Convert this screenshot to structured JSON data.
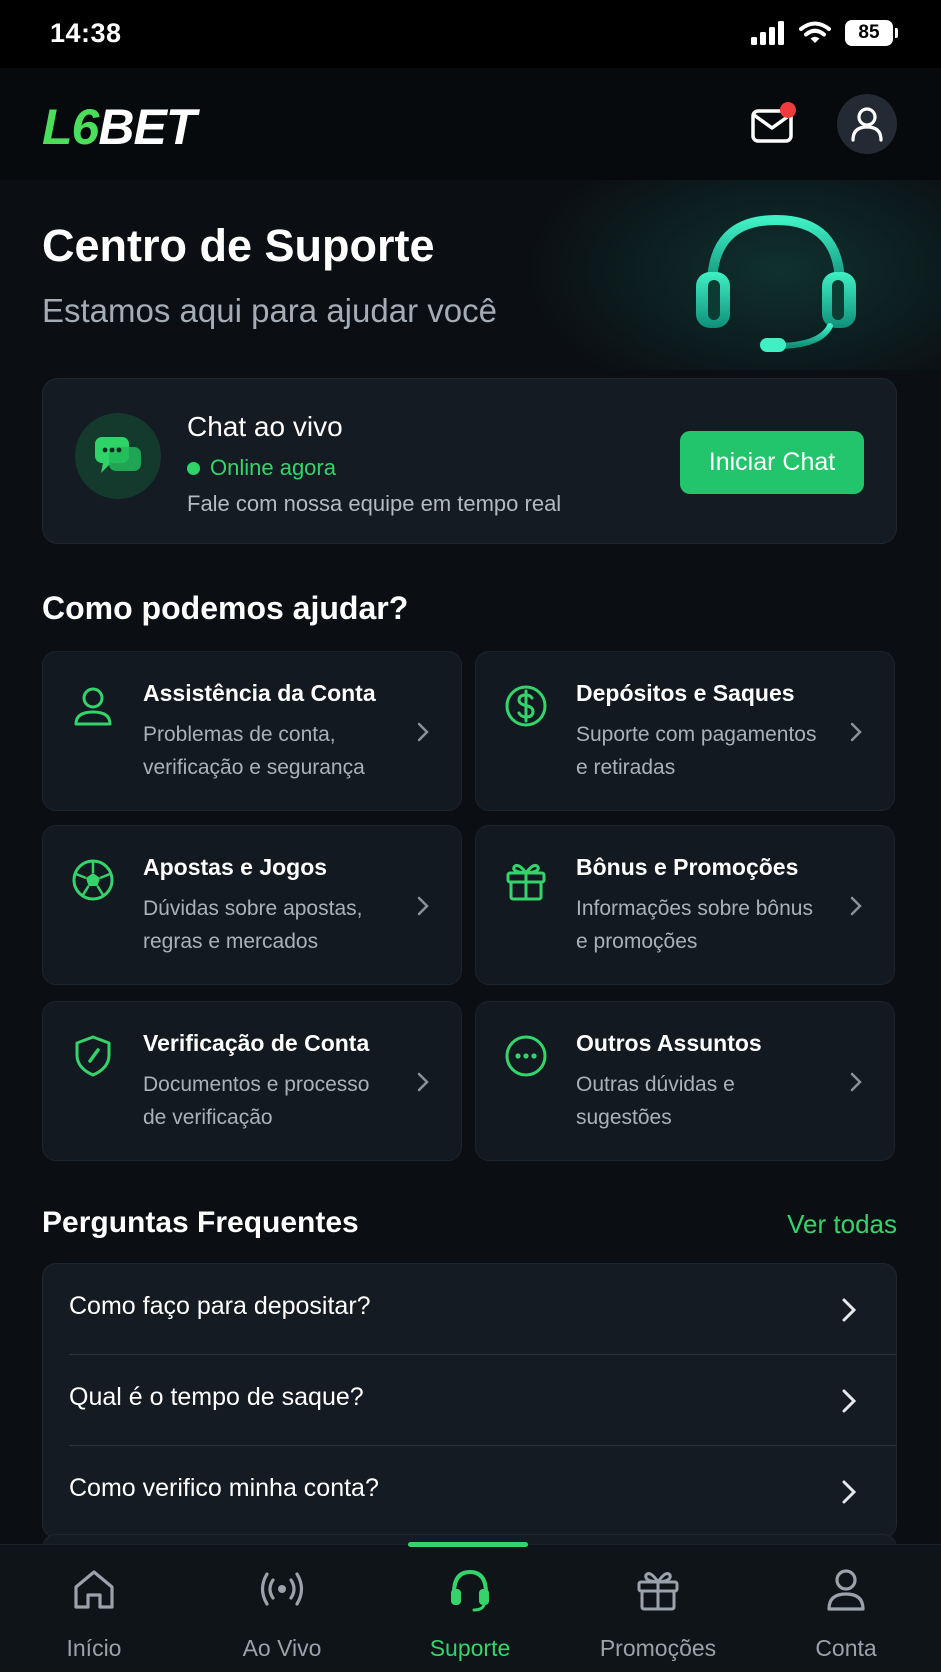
{
  "status_bar": {
    "time": "14:38",
    "battery": "85"
  },
  "header": {
    "logo_accent": "L6",
    "logo_main": "BET",
    "unread_mail": true
  },
  "hero": {
    "title": "Centro de Suporte",
    "subtitle": "Estamos aqui para ajudar você"
  },
  "live_chat": {
    "title": "Chat ao vivo",
    "status": "Online agora",
    "description": "Fale com nossa equipe em tempo real",
    "button": "Iniciar Chat"
  },
  "help_section": {
    "title": "Como podemos ajudar?",
    "categories": [
      {
        "icon": "user-icon",
        "title": "Assistência da Conta",
        "line1": "Problemas de conta,",
        "line2": "verificação e segurança"
      },
      {
        "icon": "dollar-icon",
        "title": "Depósitos e Saques",
        "line1": "Suporte com pagamentos",
        "line2": "e retiradas"
      },
      {
        "icon": "soccer-ball-icon",
        "title": "Apostas e Jogos",
        "line1": "Dúvidas sobre apostas,",
        "line2": "regras e mercados"
      },
      {
        "icon": "gift-icon",
        "title": "Bônus e Promoções",
        "line1": "Informações sobre bônus",
        "line2": "e promoções"
      },
      {
        "icon": "shield-icon",
        "title": "Verificação de Conta",
        "line1": "Documentos e processo",
        "line2": "de verificação"
      },
      {
        "icon": "more-icon",
        "title": "Outros Assuntos",
        "line1": "Outras dúvidas e",
        "line2": "sugestões"
      }
    ]
  },
  "faq": {
    "title": "Perguntas Frequentes",
    "link": "Ver todas",
    "items": [
      "Como faço para depositar?",
      "Qual é o tempo de saque?",
      "Como verifico minha conta?"
    ]
  },
  "bottom_nav": {
    "active": "Suporte",
    "items": [
      {
        "icon": "home-icon",
        "label": "Início"
      },
      {
        "icon": "live-broadcast-icon",
        "label": "Ao Vivo"
      },
      {
        "icon": "headset-icon",
        "label": "Suporte"
      },
      {
        "icon": "gift-icon",
        "label": "Promoções"
      },
      {
        "icon": "user-icon",
        "label": "Conta"
      }
    ]
  },
  "colors": {
    "accent": "#34d46b",
    "button": "#22c56b",
    "background": "#0b0f13",
    "card": "#151b22",
    "notification": "#ef3b3b"
  }
}
